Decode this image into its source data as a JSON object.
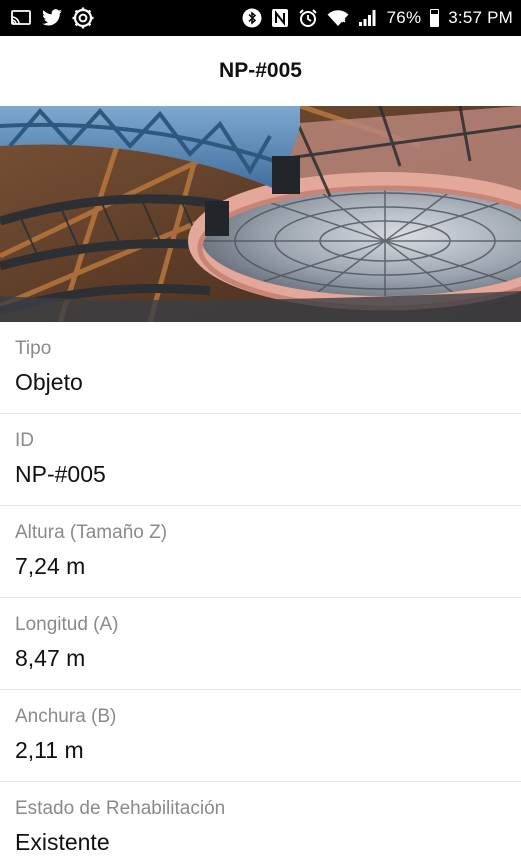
{
  "status_bar": {
    "battery_percent": "76%",
    "time": "3:57 PM",
    "icons": [
      "cast-icon",
      "twitter-icon",
      "settings-gear-icon",
      "bluetooth-icon",
      "nfc-icon",
      "alarm-icon",
      "wifi-icon",
      "signal-icon",
      "battery-icon"
    ]
  },
  "header": {
    "title": "NP-#005"
  },
  "hero_image": {
    "description_icon": "dome-structure-photo"
  },
  "fields": [
    {
      "label": "Tipo",
      "value": "Objeto"
    },
    {
      "label": "ID",
      "value": "NP-#005"
    },
    {
      "label": "Altura (Tamaño Z)",
      "value": "7,24 m"
    },
    {
      "label": "Longitud (A)",
      "value": "8,47 m"
    },
    {
      "label": "Anchura (B)",
      "value": "2,11 m"
    },
    {
      "label": "Estado de Rehabilitación",
      "value": "Existente"
    }
  ],
  "colors": {
    "status_bar_bg": "#000000",
    "header_bg": "#ffffff",
    "label_text": "#8a8a8a",
    "value_text": "#111111",
    "divider": "#e2e2e2"
  }
}
